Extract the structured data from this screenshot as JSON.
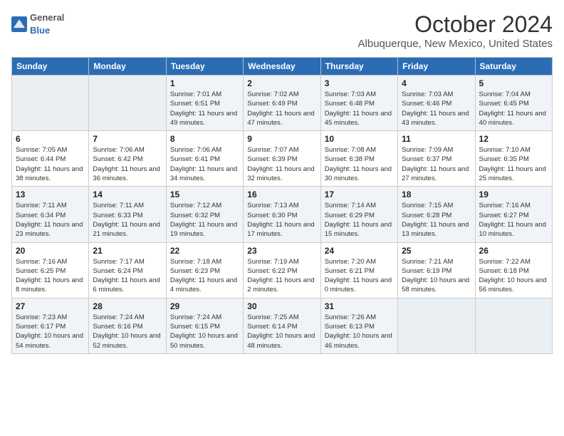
{
  "logo": {
    "general": "General",
    "blue": "Blue"
  },
  "title": "October 2024",
  "location": "Albuquerque, New Mexico, United States",
  "headers": [
    "Sunday",
    "Monday",
    "Tuesday",
    "Wednesday",
    "Thursday",
    "Friday",
    "Saturday"
  ],
  "weeks": [
    [
      {
        "day": "",
        "empty": true
      },
      {
        "day": "",
        "empty": true
      },
      {
        "day": "1",
        "sunrise": "7:01 AM",
        "sunset": "6:51 PM",
        "daylight": "11 hours and 49 minutes."
      },
      {
        "day": "2",
        "sunrise": "7:02 AM",
        "sunset": "6:49 PM",
        "daylight": "11 hours and 47 minutes."
      },
      {
        "day": "3",
        "sunrise": "7:03 AM",
        "sunset": "6:48 PM",
        "daylight": "11 hours and 45 minutes."
      },
      {
        "day": "4",
        "sunrise": "7:03 AM",
        "sunset": "6:46 PM",
        "daylight": "11 hours and 43 minutes."
      },
      {
        "day": "5",
        "sunrise": "7:04 AM",
        "sunset": "6:45 PM",
        "daylight": "11 hours and 40 minutes."
      }
    ],
    [
      {
        "day": "6",
        "sunrise": "7:05 AM",
        "sunset": "6:44 PM",
        "daylight": "11 hours and 38 minutes."
      },
      {
        "day": "7",
        "sunrise": "7:06 AM",
        "sunset": "6:42 PM",
        "daylight": "11 hours and 36 minutes."
      },
      {
        "day": "8",
        "sunrise": "7:06 AM",
        "sunset": "6:41 PM",
        "daylight": "11 hours and 34 minutes."
      },
      {
        "day": "9",
        "sunrise": "7:07 AM",
        "sunset": "6:39 PM",
        "daylight": "11 hours and 32 minutes."
      },
      {
        "day": "10",
        "sunrise": "7:08 AM",
        "sunset": "6:38 PM",
        "daylight": "11 hours and 30 minutes."
      },
      {
        "day": "11",
        "sunrise": "7:09 AM",
        "sunset": "6:37 PM",
        "daylight": "11 hours and 27 minutes."
      },
      {
        "day": "12",
        "sunrise": "7:10 AM",
        "sunset": "6:35 PM",
        "daylight": "11 hours and 25 minutes."
      }
    ],
    [
      {
        "day": "13",
        "sunrise": "7:11 AM",
        "sunset": "6:34 PM",
        "daylight": "11 hours and 23 minutes."
      },
      {
        "day": "14",
        "sunrise": "7:11 AM",
        "sunset": "6:33 PM",
        "daylight": "11 hours and 21 minutes."
      },
      {
        "day": "15",
        "sunrise": "7:12 AM",
        "sunset": "6:32 PM",
        "daylight": "11 hours and 19 minutes."
      },
      {
        "day": "16",
        "sunrise": "7:13 AM",
        "sunset": "6:30 PM",
        "daylight": "11 hours and 17 minutes."
      },
      {
        "day": "17",
        "sunrise": "7:14 AM",
        "sunset": "6:29 PM",
        "daylight": "11 hours and 15 minutes."
      },
      {
        "day": "18",
        "sunrise": "7:15 AM",
        "sunset": "6:28 PM",
        "daylight": "11 hours and 13 minutes."
      },
      {
        "day": "19",
        "sunrise": "7:16 AM",
        "sunset": "6:27 PM",
        "daylight": "11 hours and 10 minutes."
      }
    ],
    [
      {
        "day": "20",
        "sunrise": "7:16 AM",
        "sunset": "6:25 PM",
        "daylight": "11 hours and 8 minutes."
      },
      {
        "day": "21",
        "sunrise": "7:17 AM",
        "sunset": "6:24 PM",
        "daylight": "11 hours and 6 minutes."
      },
      {
        "day": "22",
        "sunrise": "7:18 AM",
        "sunset": "6:23 PM",
        "daylight": "11 hours and 4 minutes."
      },
      {
        "day": "23",
        "sunrise": "7:19 AM",
        "sunset": "6:22 PM",
        "daylight": "11 hours and 2 minutes."
      },
      {
        "day": "24",
        "sunrise": "7:20 AM",
        "sunset": "6:21 PM",
        "daylight": "11 hours and 0 minutes."
      },
      {
        "day": "25",
        "sunrise": "7:21 AM",
        "sunset": "6:19 PM",
        "daylight": "10 hours and 58 minutes."
      },
      {
        "day": "26",
        "sunrise": "7:22 AM",
        "sunset": "6:18 PM",
        "daylight": "10 hours and 56 minutes."
      }
    ],
    [
      {
        "day": "27",
        "sunrise": "7:23 AM",
        "sunset": "6:17 PM",
        "daylight": "10 hours and 54 minutes."
      },
      {
        "day": "28",
        "sunrise": "7:24 AM",
        "sunset": "6:16 PM",
        "daylight": "10 hours and 52 minutes."
      },
      {
        "day": "29",
        "sunrise": "7:24 AM",
        "sunset": "6:15 PM",
        "daylight": "10 hours and 50 minutes."
      },
      {
        "day": "30",
        "sunrise": "7:25 AM",
        "sunset": "6:14 PM",
        "daylight": "10 hours and 48 minutes."
      },
      {
        "day": "31",
        "sunrise": "7:26 AM",
        "sunset": "6:13 PM",
        "daylight": "10 hours and 46 minutes."
      },
      {
        "day": "",
        "empty": true
      },
      {
        "day": "",
        "empty": true
      }
    ]
  ]
}
